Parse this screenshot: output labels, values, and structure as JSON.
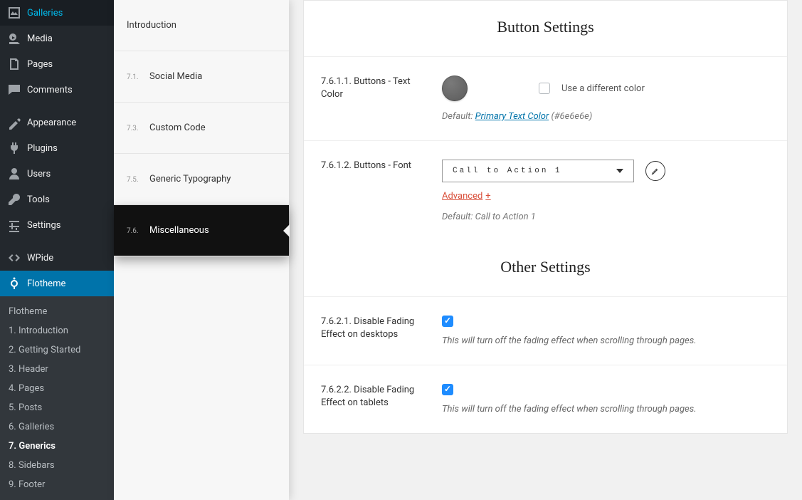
{
  "primary_nav": {
    "items_top": [
      {
        "label": "Galleries",
        "icon": "galleries"
      },
      {
        "label": "Media",
        "icon": "media"
      },
      {
        "label": "Pages",
        "icon": "pages"
      },
      {
        "label": "Comments",
        "icon": "comments"
      }
    ],
    "items_mid": [
      {
        "label": "Appearance",
        "icon": "appearance"
      },
      {
        "label": "Plugins",
        "icon": "plugins"
      },
      {
        "label": "Users",
        "icon": "users"
      },
      {
        "label": "Tools",
        "icon": "tools"
      },
      {
        "label": "Settings",
        "icon": "settings"
      }
    ],
    "items_bottom": [
      {
        "label": "WPide",
        "icon": "code",
        "active": false
      },
      {
        "label": "Flotheme",
        "icon": "flotheme",
        "active": true
      }
    ]
  },
  "submenu": {
    "items": [
      {
        "label": "Flotheme"
      },
      {
        "label": "1. Introduction"
      },
      {
        "label": "2. Getting Started"
      },
      {
        "label": "3. Header"
      },
      {
        "label": "4. Pages"
      },
      {
        "label": "5. Posts"
      },
      {
        "label": "6. Galleries"
      },
      {
        "label": "7. Generics",
        "current": true
      },
      {
        "label": "8. Sidebars"
      },
      {
        "label": "9. Footer"
      }
    ]
  },
  "secondary_nav": {
    "intro_label": "Introduction",
    "items": [
      {
        "num": "7.1.",
        "label": "Social Media"
      },
      {
        "num": "7.3.",
        "label": "Custom Code"
      },
      {
        "num": "7.5.",
        "label": "Generic Typography"
      },
      {
        "num": "7.6.",
        "label": "Miscellaneous",
        "active": true
      }
    ]
  },
  "content": {
    "section1": {
      "title": "Button Settings",
      "row1": {
        "label": "7.6.1.1. Buttons - Text Color",
        "diff_label": "Use a different color",
        "default_prefix": "Default: ",
        "default_link": "Primary Text Color",
        "default_hex": "(#6e6e6e)"
      },
      "row2": {
        "label": "7.6.1.2. Buttons - Font",
        "select_value": "Call to Action 1",
        "advanced_label": "Advanced",
        "advanced_plus": "+",
        "default_text": "Default: Call to Action 1"
      }
    },
    "section2": {
      "title": "Other Settings",
      "row1": {
        "label": "7.6.2.1. Disable Fading Effect on desktops",
        "desc": "This will turn off the fading effect when scrolling through pages."
      },
      "row2": {
        "label": "7.6.2.2. Disable Fading Effect on tablets",
        "desc": "This will turn off the fading effect when scrolling through pages."
      }
    }
  }
}
